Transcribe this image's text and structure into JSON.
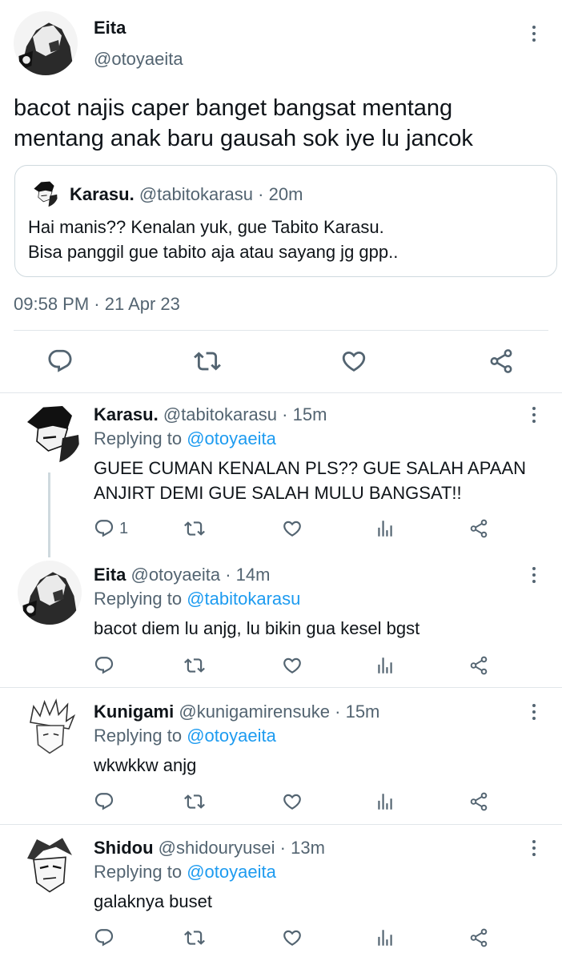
{
  "main_tweet": {
    "name": "Eita",
    "handle": "@otoyaeita",
    "text_line1": "bacot najis caper banget bangsat mentang",
    "text_line2": "mentang anak baru gausah sok iye lu jancok",
    "timestamp": "09:58 PM · 21 Apr 23",
    "quoted": {
      "name": "Karasu.",
      "handle": "@tabitokarasu",
      "time": "· 20m",
      "text_line1": "Hai manis?? Kenalan yuk, gue Tabito Karasu.",
      "text_line2": "Bisa panggil gue tabito aja atau sayang jg gpp.."
    }
  },
  "reply_prefix": "Replying to",
  "replies": [
    {
      "name": "Karasu.",
      "handle": "@tabitokarasu",
      "time": "· 15m",
      "replying_to": "@otoyaeita",
      "text_line1": "GUEE CUMAN KENALAN PLS?? GUE SALAH APAAN",
      "text_line2": "ANJIRT DEMI GUE SALAH MULU BANGSAT!!",
      "reply_count": "1"
    },
    {
      "name": "Eita",
      "handle": "@otoyaeita",
      "time": "· 14m",
      "replying_to": "@tabitokarasu",
      "text_line1": "bacot diem lu anjg, lu bikin gua kesel bgst"
    },
    {
      "name": "Kunigami",
      "handle": "@kunigamirensuke",
      "time": "· 15m",
      "replying_to": "@otoyaeita",
      "text_line1": "wkwkkw anjg"
    },
    {
      "name": "Shidou",
      "handle": "@shidouryusei",
      "time": "· 13m",
      "replying_to": "@otoyaeita",
      "text_line1": "galaknya buset"
    }
  ],
  "icons": [
    "reply-icon",
    "retweet-icon",
    "like-icon",
    "analytics-icon",
    "share-icon",
    "more-icon"
  ],
  "colors": {
    "link": "#1d9bf0",
    "muted": "#536471",
    "text": "#0f1419",
    "divider": "#e1e6ea"
  }
}
